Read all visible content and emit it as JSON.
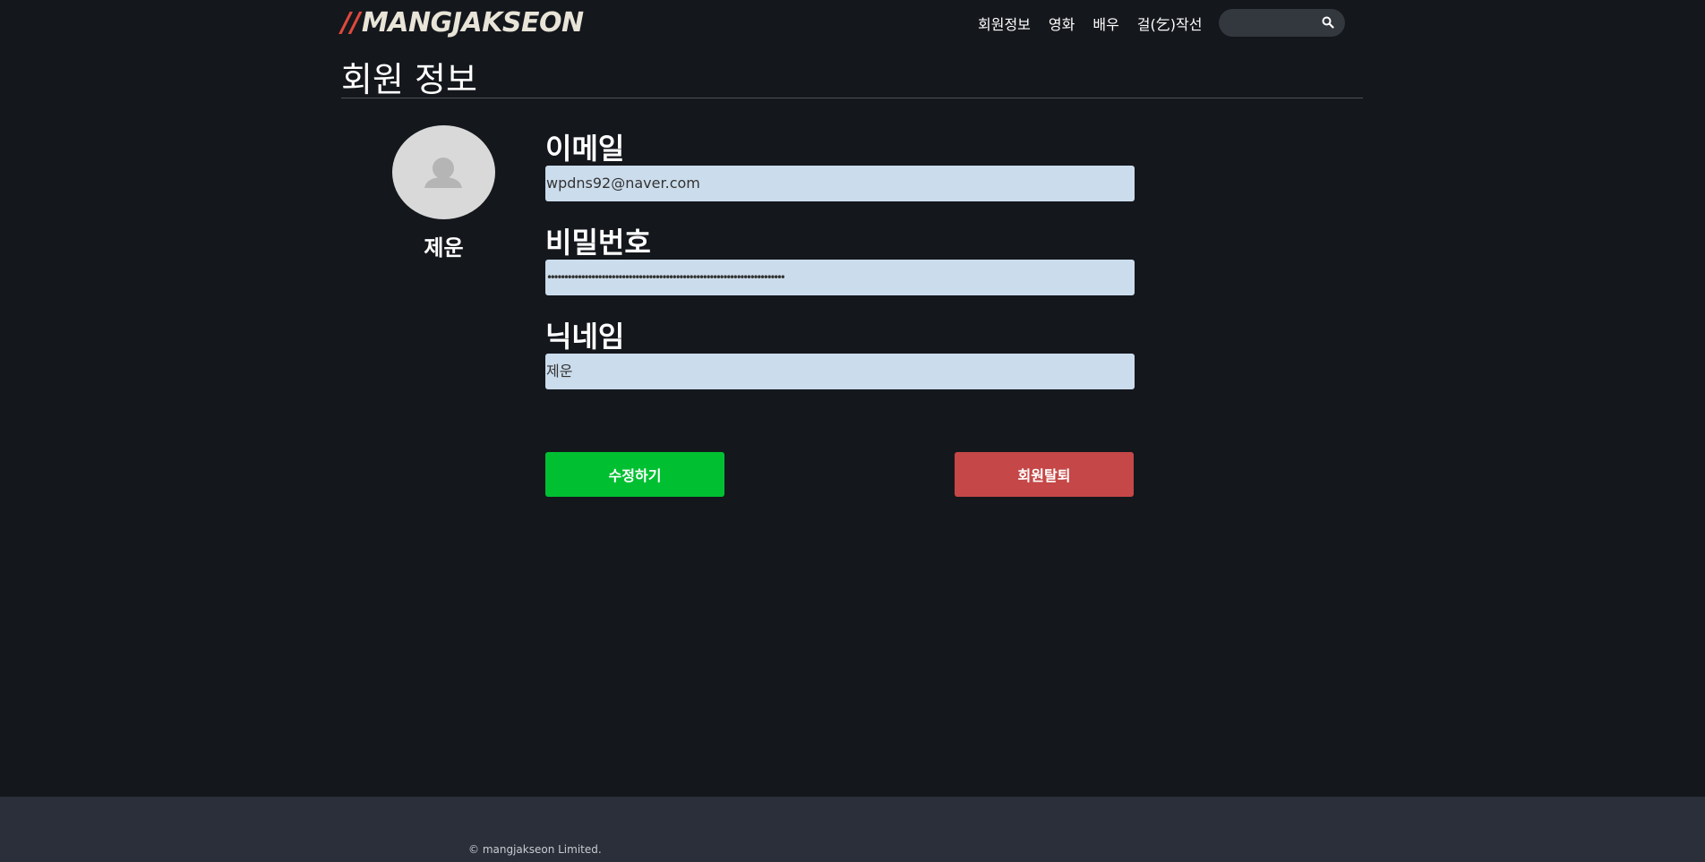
{
  "header": {
    "logo_slashes": "//",
    "logo_text": "MANGJAKSEON",
    "nav": [
      "회원정보",
      "영화",
      "배우",
      "걸(乞)작선"
    ],
    "search_placeholder": ""
  },
  "page": {
    "title": "회원 정보"
  },
  "profile": {
    "name": "제운"
  },
  "form": {
    "email_label": "이메일",
    "email_value": "wpdns92@naver.com",
    "password_label": "비밀번호",
    "password_value": "••••••••••••••••••••••••••••••••••••••••••••••••••••••••••••••••••••••",
    "nickname_label": "닉네임",
    "nickname_value": "제운"
  },
  "buttons": {
    "edit_label": "수정하기",
    "withdraw_label": "회원탈퇴"
  },
  "footer": {
    "copyright": "© mangjakseon Limited."
  },
  "colors": {
    "background": "#14171c",
    "footer": "#2a2f39",
    "input": "#cbdcec",
    "edit_button": "#00c032",
    "withdraw_button": "#c54747",
    "logo_accent": "#e0483c"
  }
}
